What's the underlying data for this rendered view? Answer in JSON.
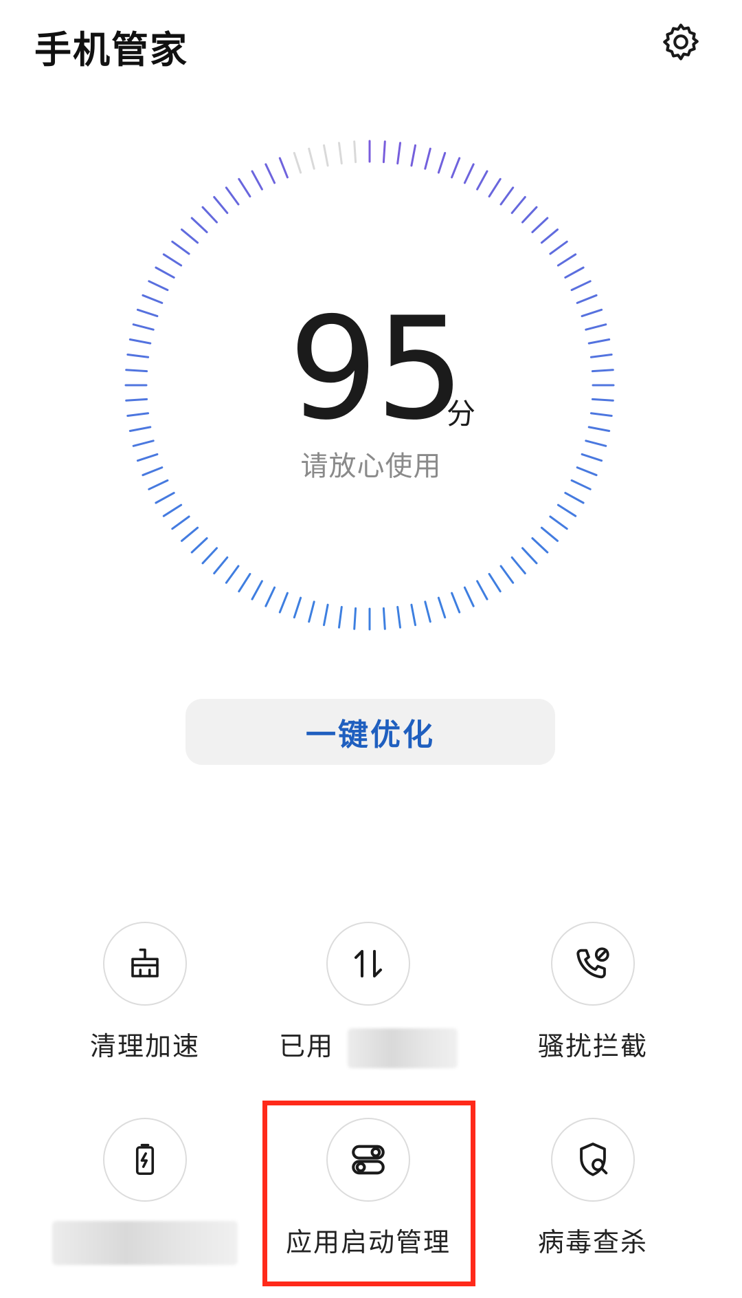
{
  "header": {
    "title": "手机管家",
    "settings_icon": "gear-icon"
  },
  "score": {
    "value": "95",
    "unit": "分",
    "status": "请放心使用",
    "level": 0.95
  },
  "optimize_button": {
    "label": "一键优化"
  },
  "tools": [
    {
      "label": "清理加速",
      "icon": "broom-icon"
    },
    {
      "label": "已用",
      "icon": "data-transfer-icon"
    },
    {
      "label": "骚扰拦截",
      "icon": "phone-block-icon"
    },
    {
      "label": "",
      "icon": "battery-charging-icon"
    },
    {
      "label": "应用启动管理",
      "icon": "toggle-apps-icon"
    },
    {
      "label": "病毒查杀",
      "icon": "shield-search-icon"
    }
  ],
  "colors": {
    "gauge_start": "#3d7fe0",
    "gauge_end": "#7a5cdc",
    "gauge_inactive": "#d9d9d9",
    "accent": "#1f5fbf",
    "highlight": "#ff2a1a"
  }
}
